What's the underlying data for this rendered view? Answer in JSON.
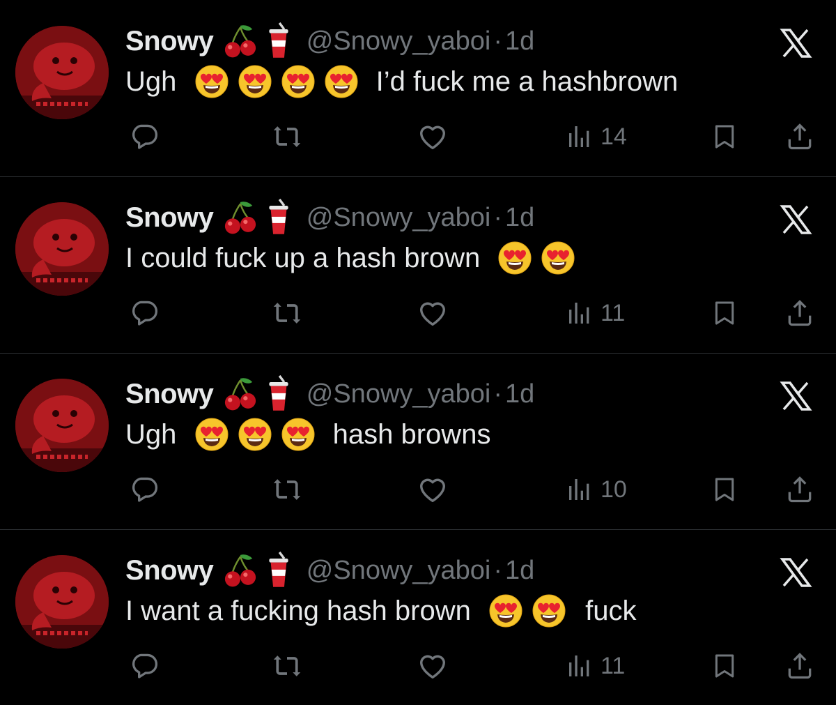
{
  "tweets": [
    {
      "name": "Snowy",
      "name_emojis": [
        "cherries-emoji",
        "cup-with-straw-emoji"
      ],
      "handle": "@Snowy_yaboi",
      "separator": "·",
      "time": "1d",
      "text_parts": [
        "Ugh",
        "heart-eyes",
        "heart-eyes",
        "heart-eyes",
        "heart-eyes",
        "I’d fuck me a hashbrown"
      ],
      "segments": {
        "t0": "Ugh",
        "t1": "I’d fuck me a hashbrown"
      },
      "views": "14"
    },
    {
      "name": "Snowy",
      "name_emojis": [
        "cherries-emoji",
        "cup-with-straw-emoji"
      ],
      "handle": "@Snowy_yaboi",
      "separator": "·",
      "time": "1d",
      "segments": {
        "t0": "I could fuck up a hash brown"
      },
      "views": "11"
    },
    {
      "name": "Snowy",
      "name_emojis": [
        "cherries-emoji",
        "cup-with-straw-emoji"
      ],
      "handle": "@Snowy_yaboi",
      "separator": "·",
      "time": "1d",
      "segments": {
        "t0": "Ugh",
        "t1": "hash browns"
      },
      "views": "10"
    },
    {
      "name": "Snowy",
      "name_emojis": [
        "cherries-emoji",
        "cup-with-straw-emoji"
      ],
      "handle": "@Snowy_yaboi",
      "separator": "·",
      "time": "1d",
      "segments": {
        "t0": "I want a fucking hash brown",
        "t1": "fuck"
      },
      "views": "11"
    }
  ],
  "icons": {
    "close": "x-logo-icon",
    "reply": "reply-icon",
    "retweet": "retweet-icon",
    "like": "heart-icon",
    "views": "views-icon",
    "bookmark": "bookmark-icon",
    "share": "share-icon"
  },
  "colors": {
    "background": "#000000",
    "text": "#e7e9ea",
    "muted": "#71767b",
    "divider": "#2f3336",
    "avatar": "#7a0f12"
  }
}
